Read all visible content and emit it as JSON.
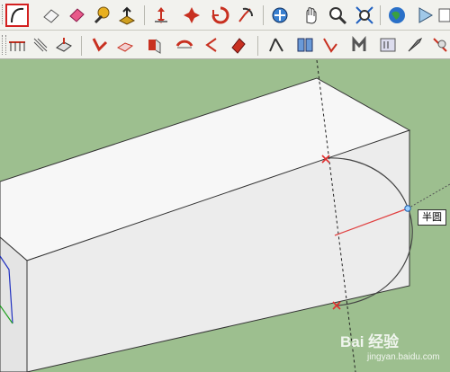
{
  "toolbar": {
    "row1": [
      "arc-tool-icon",
      "eraser-icon",
      "paint-bucket-icon",
      "tape-measure-icon",
      "push-pull-icon",
      "move-icon",
      "rotate-icon",
      "offset-icon",
      "orbit-icon",
      "pan-icon",
      "zoom-icon",
      "zoom-extents-icon",
      "get-models-icon",
      "share-model-icon"
    ],
    "row2": [
      "rectangle-icon",
      "line-icon",
      "section-plane-icon",
      "follow-me-icon",
      "scale-icon",
      "position-camera-icon",
      "walk-icon",
      "look-around-icon",
      "dimension-icon",
      "text-icon",
      "axes-icon",
      "3d-text-icon",
      "protractor-icon",
      "layers-icon"
    ]
  },
  "tooltip": {
    "label": "半圆"
  },
  "watermark": {
    "logo": "Bai 经验",
    "sub": "jingyan.baidu.com"
  },
  "colors": {
    "background": "#9dbf8f",
    "box": "#ededed",
    "axis_red": "#e04040",
    "axis_green": "#20a020",
    "inference_x": "#e03030"
  }
}
